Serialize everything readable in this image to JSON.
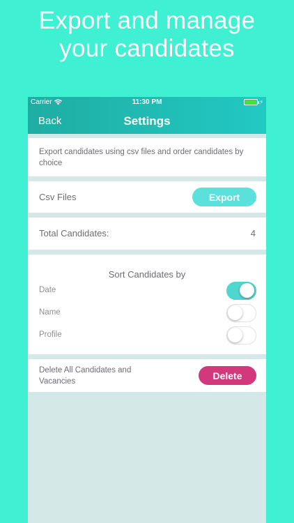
{
  "promo": {
    "line1": "Export and manage",
    "line2": "your candidates"
  },
  "status_bar": {
    "carrier": "Carrier",
    "time": "11:30 PM",
    "icons": [
      "wifi-icon",
      "battery-icon",
      "charging-bolt-icon"
    ]
  },
  "nav": {
    "back_label": "Back",
    "title": "Settings"
  },
  "description": "Export candidates using csv files and order candidates by choice",
  "csv": {
    "label": "Csv Files",
    "button_label": "Export"
  },
  "total": {
    "label": "Total Candidates:",
    "value": "4"
  },
  "sort": {
    "title": "Sort Candidates by",
    "options": [
      {
        "label": "Date",
        "enabled": true
      },
      {
        "label": "Name",
        "enabled": false
      },
      {
        "label": "Profile",
        "enabled": false
      }
    ]
  },
  "danger": {
    "label": "Delete All Candidates and Vacancies",
    "button_label": "Delete"
  },
  "colors": {
    "background": "#3ff0d3",
    "nav_gradient_start": "#1eada3",
    "nav_gradient_end": "#22c9c3",
    "export_button": "#5be1dc",
    "delete_button": "#d2397d",
    "toggle_on": "#4fd6cf"
  }
}
